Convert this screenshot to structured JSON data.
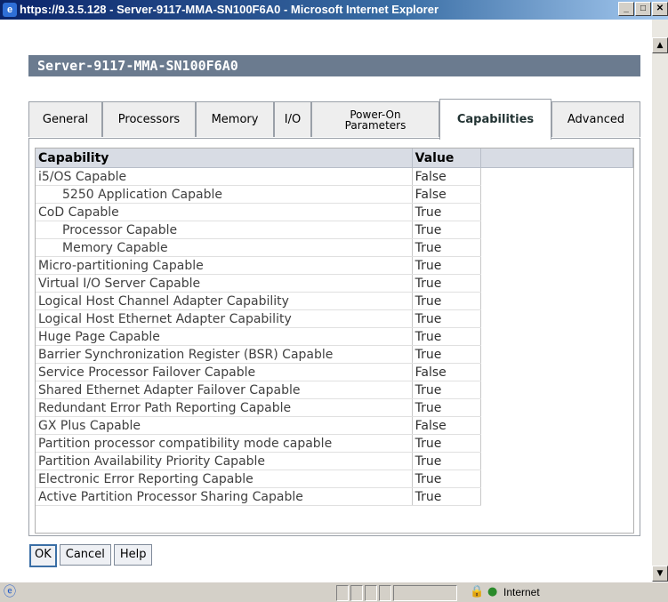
{
  "window": {
    "title": "https://9.3.5.128 - Server-9117-MMA-SN100F6A0 - Microsoft Internet Explorer",
    "controls": [
      "minimize",
      "maximize",
      "close"
    ]
  },
  "header": {
    "title": "Server-9117-MMA-SN100F6A0"
  },
  "tabs": [
    {
      "label": "General"
    },
    {
      "label": "Processors"
    },
    {
      "label": "Memory"
    },
    {
      "label": "I/O"
    },
    {
      "label": "Power-On Parameters",
      "line1": "Power-On",
      "line2": "Parameters"
    },
    {
      "label": "Capabilities",
      "active": true
    },
    {
      "label": "Advanced"
    }
  ],
  "table": {
    "columns": [
      "Capability",
      "Value"
    ],
    "rows": [
      {
        "capability": "i5/OS Capable",
        "value": "False"
      },
      {
        "capability": "5250 Application Capable",
        "value": "False"
      },
      {
        "capability": "CoD Capable",
        "value": "True"
      },
      {
        "capability": "Processor Capable",
        "value": "True"
      },
      {
        "capability": "Memory Capable",
        "value": "True"
      },
      {
        "capability": "Micro-partitioning Capable",
        "value": "True"
      },
      {
        "capability": "Virtual I/O Server Capable",
        "value": "True"
      },
      {
        "capability": "Logical Host Channel Adapter Capability",
        "value": "True"
      },
      {
        "capability": "Logical Host Ethernet Adapter Capability",
        "value": "True"
      },
      {
        "capability": "Huge Page Capable",
        "value": "True"
      },
      {
        "capability": "Barrier Synchronization Register (BSR) Capable",
        "value": "True"
      },
      {
        "capability": "Service Processor Failover Capable",
        "value": "False"
      },
      {
        "capability": "Shared Ethernet Adapter Failover Capable",
        "value": "True"
      },
      {
        "capability": "Redundant Error Path Reporting Capable",
        "value": "True"
      },
      {
        "capability": "GX Plus Capable",
        "value": "False"
      },
      {
        "capability": "Partition processor compatibility mode capable",
        "value": "True"
      },
      {
        "capability": "Partition Availability Priority Capable",
        "value": "True"
      },
      {
        "capability": "Electronic Error Reporting Capable",
        "value": "True"
      },
      {
        "capability": "Active Partition Processor Sharing Capable",
        "value": "True"
      }
    ]
  },
  "buttons": {
    "ok": "OK",
    "cancel": "Cancel",
    "help": "Help"
  },
  "statusbar": {
    "zone": "Internet",
    "icons": [
      "ie-page-icon",
      "lock-icon",
      "globe-icon"
    ]
  }
}
